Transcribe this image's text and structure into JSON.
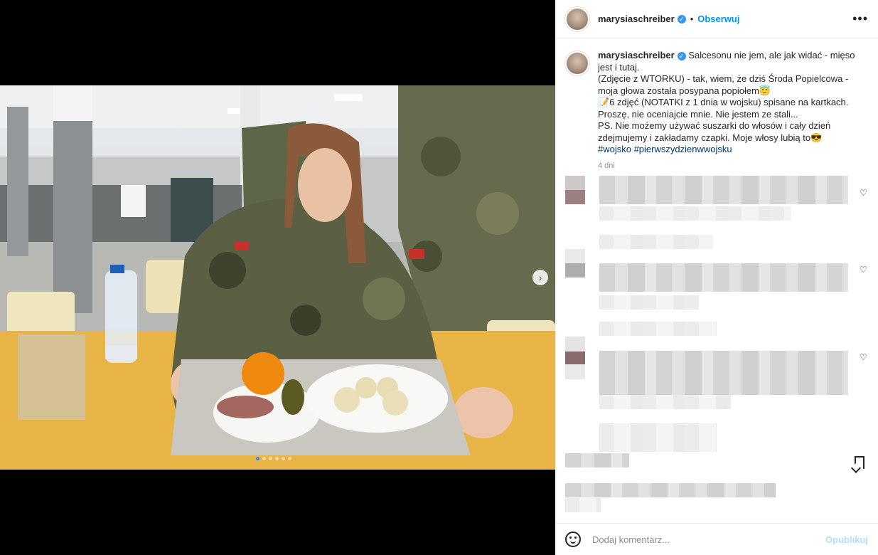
{
  "post": {
    "username": "marysiaschreiber",
    "verified_mark": "✓",
    "separator": "•",
    "follow_label": "Obserwuj",
    "more_icon": "•••",
    "caption_lines": [
      "Salcesonu nie jem, ale jak widać - mięso jest i tutaj.",
      "(Zdjęcie z WTORKU) - tak, wiem, że dziś Środa Popielcowa - moja głowa została posypana popiołem😇",
      "📝6 zdjęć (NOTATKI z 1 dnia w wojsku) spisane na kartkach. Proszę, nie oceniajcie mnie. Nie jestem ze stali...",
      "PS. Nie możemy używać suszarki do włosów i cały dzień zdejmujemy i zakładamy czapki. Moje włosy lubią to😎"
    ],
    "hashtags": "#wojsko #pierwszydzienwwojsku",
    "time": "4 dni",
    "carousel_slide_count": 6,
    "carousel_active_index": 0,
    "next_arrow": "›"
  },
  "comment_box": {
    "placeholder": "Dodaj komentarz...",
    "post_label": "Opublikuj"
  },
  "icons": {
    "heart": "♡"
  },
  "colors": {
    "accent": "#0095f6",
    "hashtag": "#00376b",
    "muted": "#8e8e8e"
  }
}
